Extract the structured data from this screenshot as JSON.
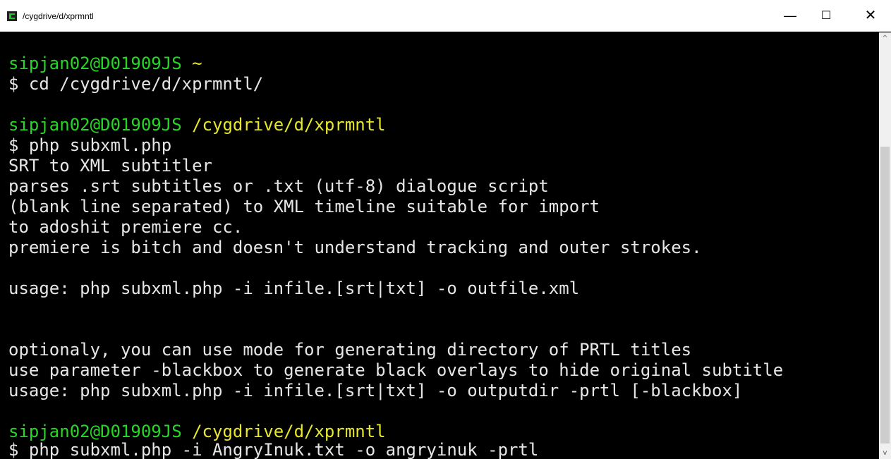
{
  "window": {
    "title": "/cygdrive/d/xprmntl",
    "minimize_glyph": "—",
    "maximize_glyph": "☐",
    "close_glyph": "✕",
    "icon": "cygwin-terminal-icon"
  },
  "console": {
    "lines": [
      {
        "user": "sipjan02@D01909JS",
        "path": "~"
      },
      {
        "text": "$ cd /cygdrive/d/xprmntl/"
      },
      {
        "text": ""
      },
      {
        "user": "sipjan02@D01909JS",
        "path": "/cygdrive/d/xprmntl"
      },
      {
        "text": "$ php subxml.php"
      },
      {
        "text": "SRT to XML subtitler"
      },
      {
        "text": "parses .srt subtitles or .txt (utf-8) dialogue script"
      },
      {
        "text": "(blank line separated) to XML timeline suitable for import"
      },
      {
        "text": "to adoshit premiere cc."
      },
      {
        "text": "premiere is bitch and doesn't understand tracking and outer strokes."
      },
      {
        "text": ""
      },
      {
        "text": "usage: php subxml.php -i infile.[srt|txt] -o outfile.xml"
      },
      {
        "text": ""
      },
      {
        "text": ""
      },
      {
        "text": "optionaly, you can use mode for generating directory of PRTL titles"
      },
      {
        "text": "use parameter -blackbox to generate black overlays to hide original subtitle"
      },
      {
        "text": "usage: php subxml.php -i infile.[srt|txt] -o outputdir -prtl [-blackbox]"
      },
      {
        "text": ""
      },
      {
        "user": "sipjan02@D01909JS",
        "path": "/cygdrive/d/xprmntl"
      },
      {
        "text": "$ php subxml.php -i AngryInuk.txt -o angryinuk -prtl"
      }
    ]
  },
  "scrollbar": {
    "up_glyph": "^",
    "down_glyph": "v"
  },
  "colors": {
    "background": "#000000",
    "text": "#e6e6e6",
    "user": "#27d627",
    "path": "#e8e82a"
  }
}
